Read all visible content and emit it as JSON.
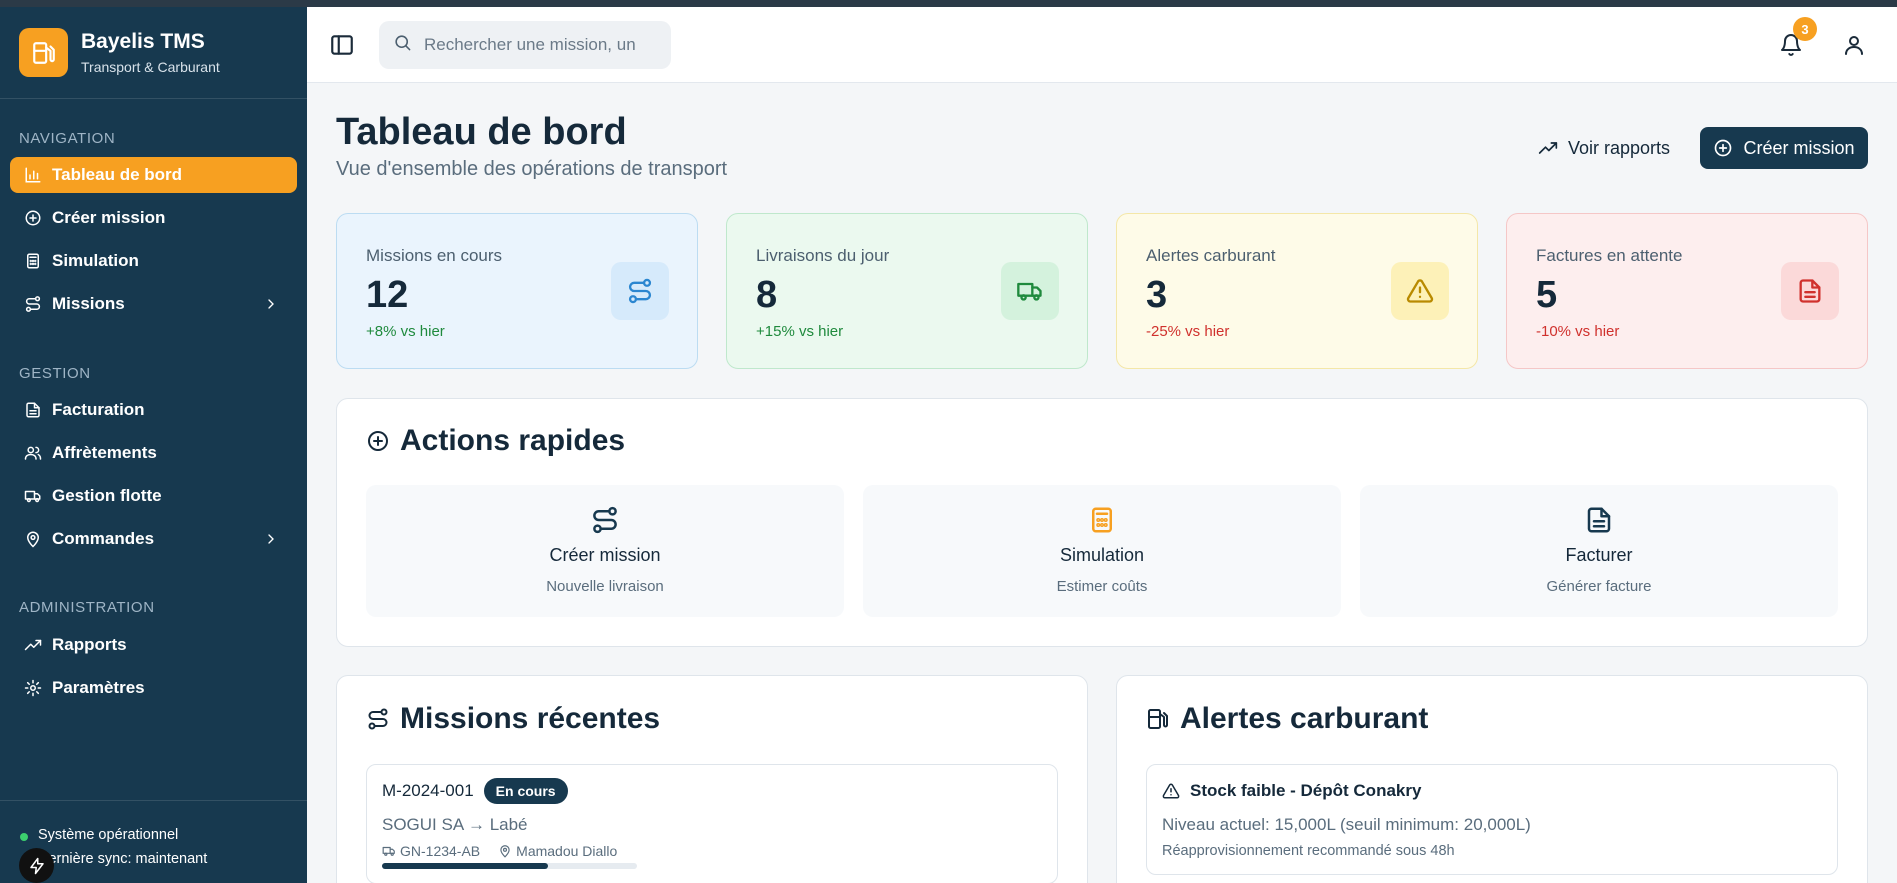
{
  "brand": {
    "title": "Bayelis TMS",
    "subtitle": "Transport & Carburant"
  },
  "sidebar": {
    "sections": [
      {
        "label": "NAVIGATION"
      },
      {
        "label": "GESTION"
      },
      {
        "label": "ADMINISTRATION"
      }
    ],
    "items": [
      {
        "label": "Tableau de bord",
        "icon": "bar-chart-icon",
        "active": true
      },
      {
        "label": "Créer mission",
        "icon": "plus-circle-icon"
      },
      {
        "label": "Simulation",
        "icon": "calculator-icon"
      },
      {
        "label": "Missions",
        "icon": "route-icon",
        "has_submenu": true
      },
      {
        "label": "Facturation",
        "icon": "file-text-icon"
      },
      {
        "label": "Affrètements",
        "icon": "users-icon"
      },
      {
        "label": "Gestion flotte",
        "icon": "truck-icon"
      },
      {
        "label": "Commandes",
        "icon": "map-pin-icon",
        "has_submenu": true
      },
      {
        "label": "Rapports",
        "icon": "trending-up-icon"
      },
      {
        "label": "Paramètres",
        "icon": "gear-icon"
      }
    ],
    "status": {
      "line1": "Système opérationnel",
      "line2": "Dernière sync: maintenant"
    }
  },
  "header": {
    "search_placeholder": "Rechercher une mission, un",
    "notification_count": "3"
  },
  "page": {
    "title": "Tableau de bord",
    "subtitle": "Vue d'ensemble des opérations de transport",
    "reports_button": "Voir rapports",
    "create_button": "Créer mission"
  },
  "stats": [
    {
      "label": "Missions en cours",
      "value": "12",
      "change": "+8% vs hier",
      "icon": "route-icon"
    },
    {
      "label": "Livraisons du jour",
      "value": "8",
      "change": "+15% vs hier",
      "icon": "truck-icon"
    },
    {
      "label": "Alertes carburant",
      "value": "3",
      "change": "-25% vs hier",
      "icon": "warning-icon"
    },
    {
      "label": "Factures en attente",
      "value": "5",
      "change": "-10% vs hier",
      "icon": "file-text-icon"
    }
  ],
  "colors": {
    "sidebar_bg": "#17394f",
    "accent": "#f7a021",
    "positive": "#1f8a3d",
    "negative": "#d0312d"
  },
  "quick_actions": {
    "title": "Actions rapides",
    "items": [
      {
        "title": "Créer mission",
        "subtitle": "Nouvelle livraison",
        "icon": "route-icon"
      },
      {
        "title": "Simulation",
        "subtitle": "Estimer coûts",
        "icon": "calculator-icon"
      },
      {
        "title": "Facturer",
        "subtitle": "Générer facture",
        "icon": "file-text-icon"
      }
    ]
  },
  "recent_missions": {
    "title": "Missions récentes",
    "items": [
      {
        "id": "M-2024-001",
        "status": "En cours",
        "route": "SOGUI SA → Labé",
        "vehicle": "GN-1234-AB",
        "driver": "Mamadou Diallo",
        "progress": 0.65
      }
    ]
  },
  "fuel_alerts": {
    "title": "Alertes carburant",
    "items": [
      {
        "title": "Stock faible - Dépôt Conakry",
        "detail": "Niveau actuel: 15,000L (seuil minimum: 20,000L)",
        "note": "Réapprovisionnement recommandé sous 48h"
      }
    ]
  }
}
